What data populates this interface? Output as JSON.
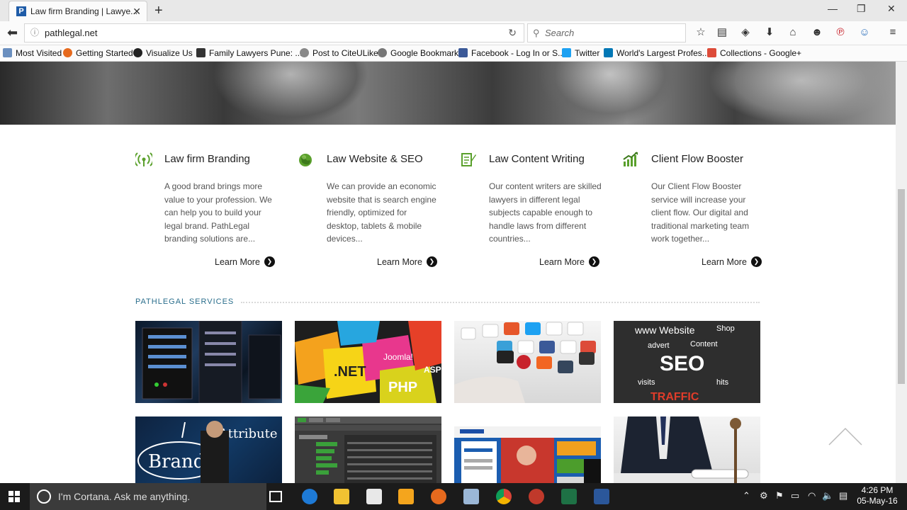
{
  "browser": {
    "tab_title": "Law firm Branding | Lawye...",
    "url": "pathlegal.net",
    "search_placeholder": "Search",
    "bookmarks": [
      "Most Visited",
      "Getting Started",
      "Visualize Us",
      "Family Lawyers Pune: ...",
      "Post to CiteULike",
      "Google Bookmark",
      "Facebook - Log In or S...",
      "Twitter",
      "World's Largest Profes...",
      "Collections - Google+"
    ]
  },
  "features": [
    {
      "title": "Law firm Branding",
      "text": "A good brand brings more value to your profession. We can help you to build your legal brand. PathLegal branding solutions are...",
      "link": "Learn More",
      "icon": "signal-icon"
    },
    {
      "title": "Law Website & SEO",
      "text": "We can provide an economic website that is search engine friendly, optimized for desktop, tablets & mobile devices...",
      "link": "Learn More",
      "icon": "globe-icon"
    },
    {
      "title": "Law Content Writing",
      "text": "Our content writers are skilled lawyers in different legal subjects capable enough to handle laws from different countries...",
      "link": "Learn More",
      "icon": "document-pen-icon"
    },
    {
      "title": "Client Flow Booster",
      "text": "Our Client Flow Booster service will increase your client flow. Our digital and traditional marketing team work together...",
      "link": "Learn More",
      "icon": "growth-chart-icon"
    }
  ],
  "services": {
    "title": "PATHLEGAL SERVICES",
    "thumb_labels": [
      ".NET",
      "Joomla!",
      "PHP",
      "ASP",
      "www Website",
      "Shop",
      "advert",
      "Content",
      "SEO",
      "visits",
      "hits",
      "TRAFFIC",
      "Attribute",
      "Brand"
    ]
  },
  "taskbar": {
    "cortana": "I'm Cortana. Ask me anything.",
    "time": "4:26 PM",
    "date": "05-May-16"
  },
  "colors": {
    "accent_green": "#5aa02c",
    "services_blue": "#2a6e8c"
  }
}
